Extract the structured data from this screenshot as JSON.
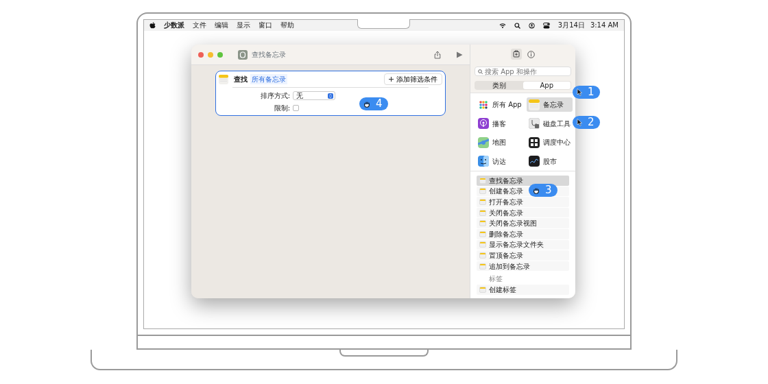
{
  "menubar": {
    "app_name": "少数派",
    "menus": [
      "文件",
      "编辑",
      "显示",
      "窗口",
      "帮助"
    ],
    "date": "3月14日",
    "time": "3:14 AM"
  },
  "window": {
    "title": "查找备忘录"
  },
  "action": {
    "verb": "查找",
    "parameter": "所有备忘录",
    "add_filter": "添加筛选条件",
    "sort_label": "排序方式:",
    "sort_value": "无",
    "limit_label": "限制:",
    "limit_checked": false
  },
  "sidebar": {
    "search_placeholder": "搜索 App 和操作",
    "segments": [
      {
        "label": "类别",
        "selected": false
      },
      {
        "label": "App",
        "selected": true
      }
    ],
    "apps": [
      {
        "name": "所有 App",
        "selected": false
      },
      {
        "name": "备忘录",
        "selected": true
      },
      {
        "name": "播客",
        "selected": false
      },
      {
        "name": "磁盘工具",
        "selected": false
      },
      {
        "name": "地图",
        "selected": false
      },
      {
        "name": "调度中心",
        "selected": false
      },
      {
        "name": "访达",
        "selected": false
      },
      {
        "name": "股市",
        "selected": false
      }
    ],
    "actions": [
      {
        "label": "查找备忘录",
        "selected": true
      },
      {
        "label": "创建备忘录",
        "selected": false
      },
      {
        "label": "打开备忘录",
        "selected": false
      },
      {
        "label": "关闭备忘录",
        "selected": false
      },
      {
        "label": "关闭备忘录视图",
        "selected": false
      },
      {
        "label": "删除备忘录",
        "selected": false
      },
      {
        "label": "显示备忘录文件夹",
        "selected": false
      },
      {
        "label": "置顶备忘录",
        "selected": false
      },
      {
        "label": "追加到备忘录",
        "selected": false
      }
    ],
    "section_label": "标签",
    "section_actions": [
      {
        "label": "创建标签",
        "selected": false
      }
    ]
  },
  "callouts": [
    {
      "number": "1",
      "kind": "arrow"
    },
    {
      "number": "2",
      "kind": "arrow"
    },
    {
      "number": "3",
      "kind": "grab"
    },
    {
      "number": "4",
      "kind": "grab"
    }
  ]
}
